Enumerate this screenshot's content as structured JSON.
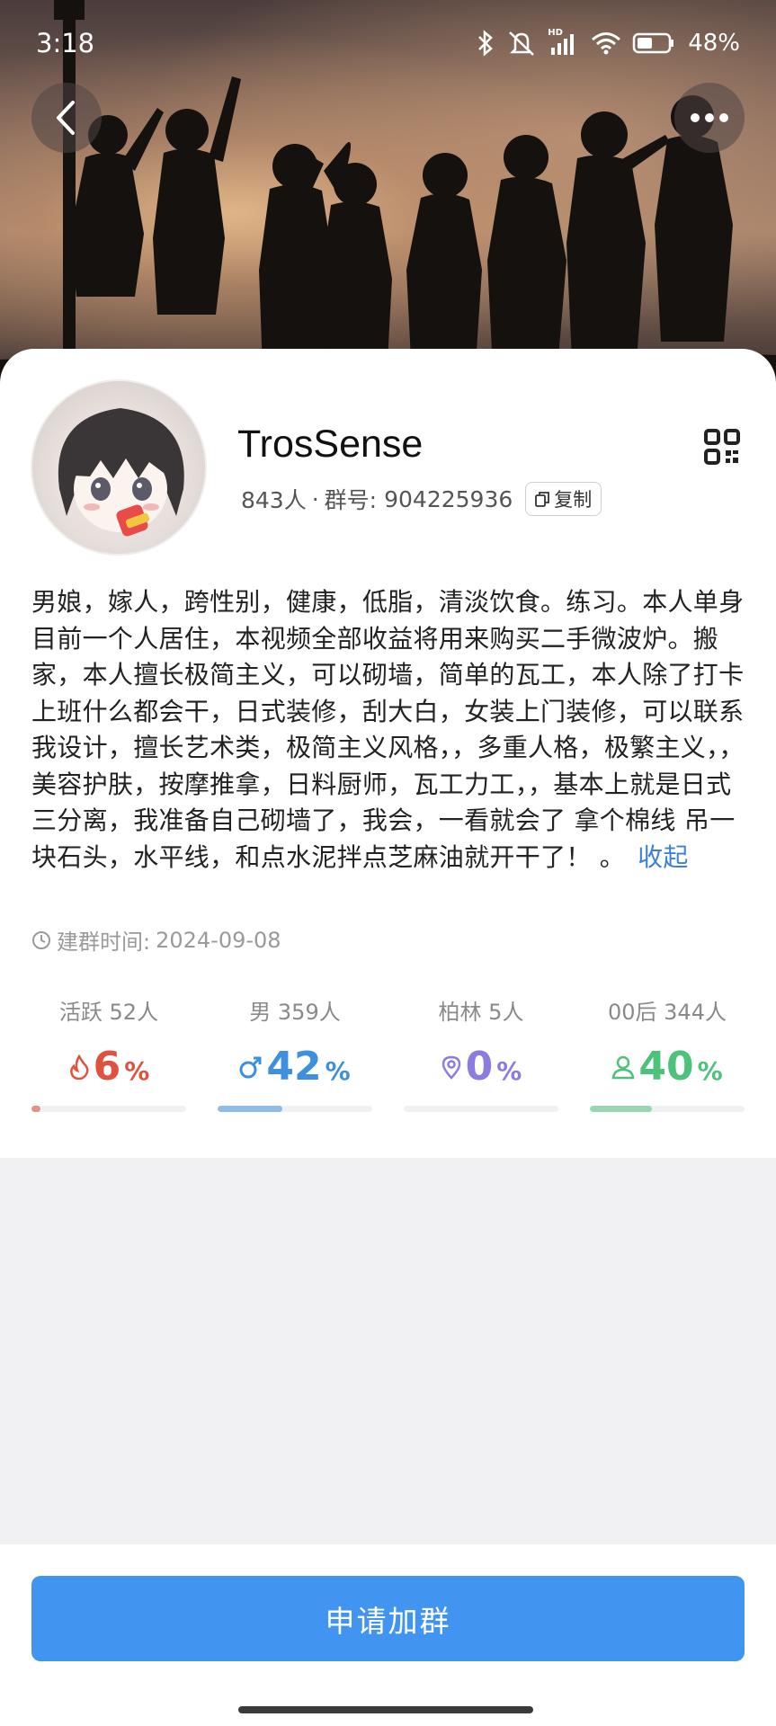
{
  "status_bar": {
    "time": "3:18",
    "hd_label": "HD",
    "battery": "48%"
  },
  "header": {
    "back_icon": "chevron-left-icon",
    "more_icon": "ellipsis-icon"
  },
  "group": {
    "name": "TrosSense",
    "members": "843人",
    "separator": "·",
    "group_number_label": "群号:",
    "group_number": "904225936",
    "copy_label": "复制",
    "description": "男娘，嫁人，跨性别，健康，低脂，清淡饮食。练习。本人单身目前一个人居住，本视频全部收益将用来购买二手微波炉。搬家，本人擅长极简主义，可以砌墙，简单的瓦工，本人除了打卡上班什么都会干，日式装修，刮大白，女装上门装修，可以联系我设计，擅长艺术类，极简主义风格，，多重人格，极繁主义，，美容护肤，按摩推拿，日料厨师，瓦工力工，，基本上就是日式三分离，我准备自己砌墙了，我会，一看就会了 拿个棉线 吊一块石头，水平线，和点水泥拌点芝麻油就开干了！ 。",
    "collapse_label": "收起",
    "created_label": "建群时间:",
    "created_date": "2024-09-08"
  },
  "stats": [
    {
      "label": "活跃 52人",
      "value": "6",
      "unit": "%",
      "fraction": 0.06,
      "color": "#e0523f",
      "icon": "flame-icon"
    },
    {
      "label": "男 359人",
      "value": "42",
      "unit": "%",
      "fraction": 0.42,
      "color": "#3d8fe0",
      "icon": "male-icon"
    },
    {
      "label": "柏林 5人",
      "value": "0",
      "unit": "%",
      "fraction": 0.0,
      "color": "#8c7be0",
      "icon": "location-icon"
    },
    {
      "label": "00后 344人",
      "value": "40",
      "unit": "%",
      "fraction": 0.4,
      "color": "#4cc27a",
      "icon": "person-icon"
    }
  ],
  "footer": {
    "join_label": "申请加群"
  }
}
